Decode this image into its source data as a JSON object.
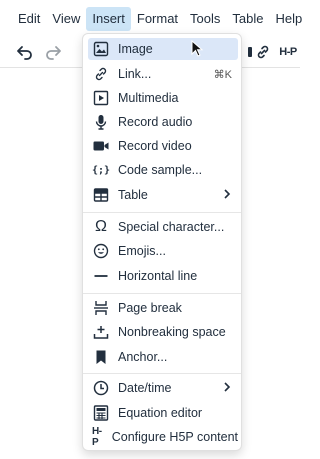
{
  "menubar": {
    "items": [
      {
        "label": "Edit"
      },
      {
        "label": "View"
      },
      {
        "label": "Insert"
      },
      {
        "label": "Format"
      },
      {
        "label": "Tools"
      },
      {
        "label": "Table"
      },
      {
        "label": "Help"
      }
    ],
    "active_index": 2
  },
  "toolbar": {
    "undo_icon": "undo-icon",
    "redo_icon": "redo-icon",
    "link_icon": "link-icon",
    "h5p_label": "H-P"
  },
  "insert_menu": {
    "items": [
      {
        "label": "Image",
        "icon": "image-icon"
      },
      {
        "label": "Link...",
        "icon": "link-icon",
        "shortcut": "⌘K"
      },
      {
        "label": "Multimedia",
        "icon": "multimedia-icon"
      },
      {
        "label": "Record audio",
        "icon": "microphone-icon"
      },
      {
        "label": "Record video",
        "icon": "video-camera-icon"
      },
      {
        "label": "Code sample...",
        "icon": "code-icon"
      },
      {
        "label": "Table",
        "icon": "table-icon"
      },
      {
        "label": "Special character...",
        "icon": "omega-icon"
      },
      {
        "label": "Emojis...",
        "icon": "emoji-icon"
      },
      {
        "label": "Horizontal line",
        "icon": "horizontal-line-icon"
      },
      {
        "label": "Page break",
        "icon": "page-break-icon"
      },
      {
        "label": "Nonbreaking space",
        "icon": "nonbreaking-space-icon"
      },
      {
        "label": "Anchor...",
        "icon": "bookmark-icon"
      },
      {
        "label": "Date/time",
        "icon": "clock-icon"
      },
      {
        "label": "Equation editor",
        "icon": "calculator-icon"
      },
      {
        "label": "Configure H5P content",
        "icon": "h5p-icon"
      }
    ],
    "code_icon_glyph": "{;}",
    "h5p_icon_glyph": "H-P"
  },
  "colors": {
    "active_menu_bg": "#cce4f6",
    "highlight_bg": "#dbe7f8",
    "text": "#222f3e"
  }
}
